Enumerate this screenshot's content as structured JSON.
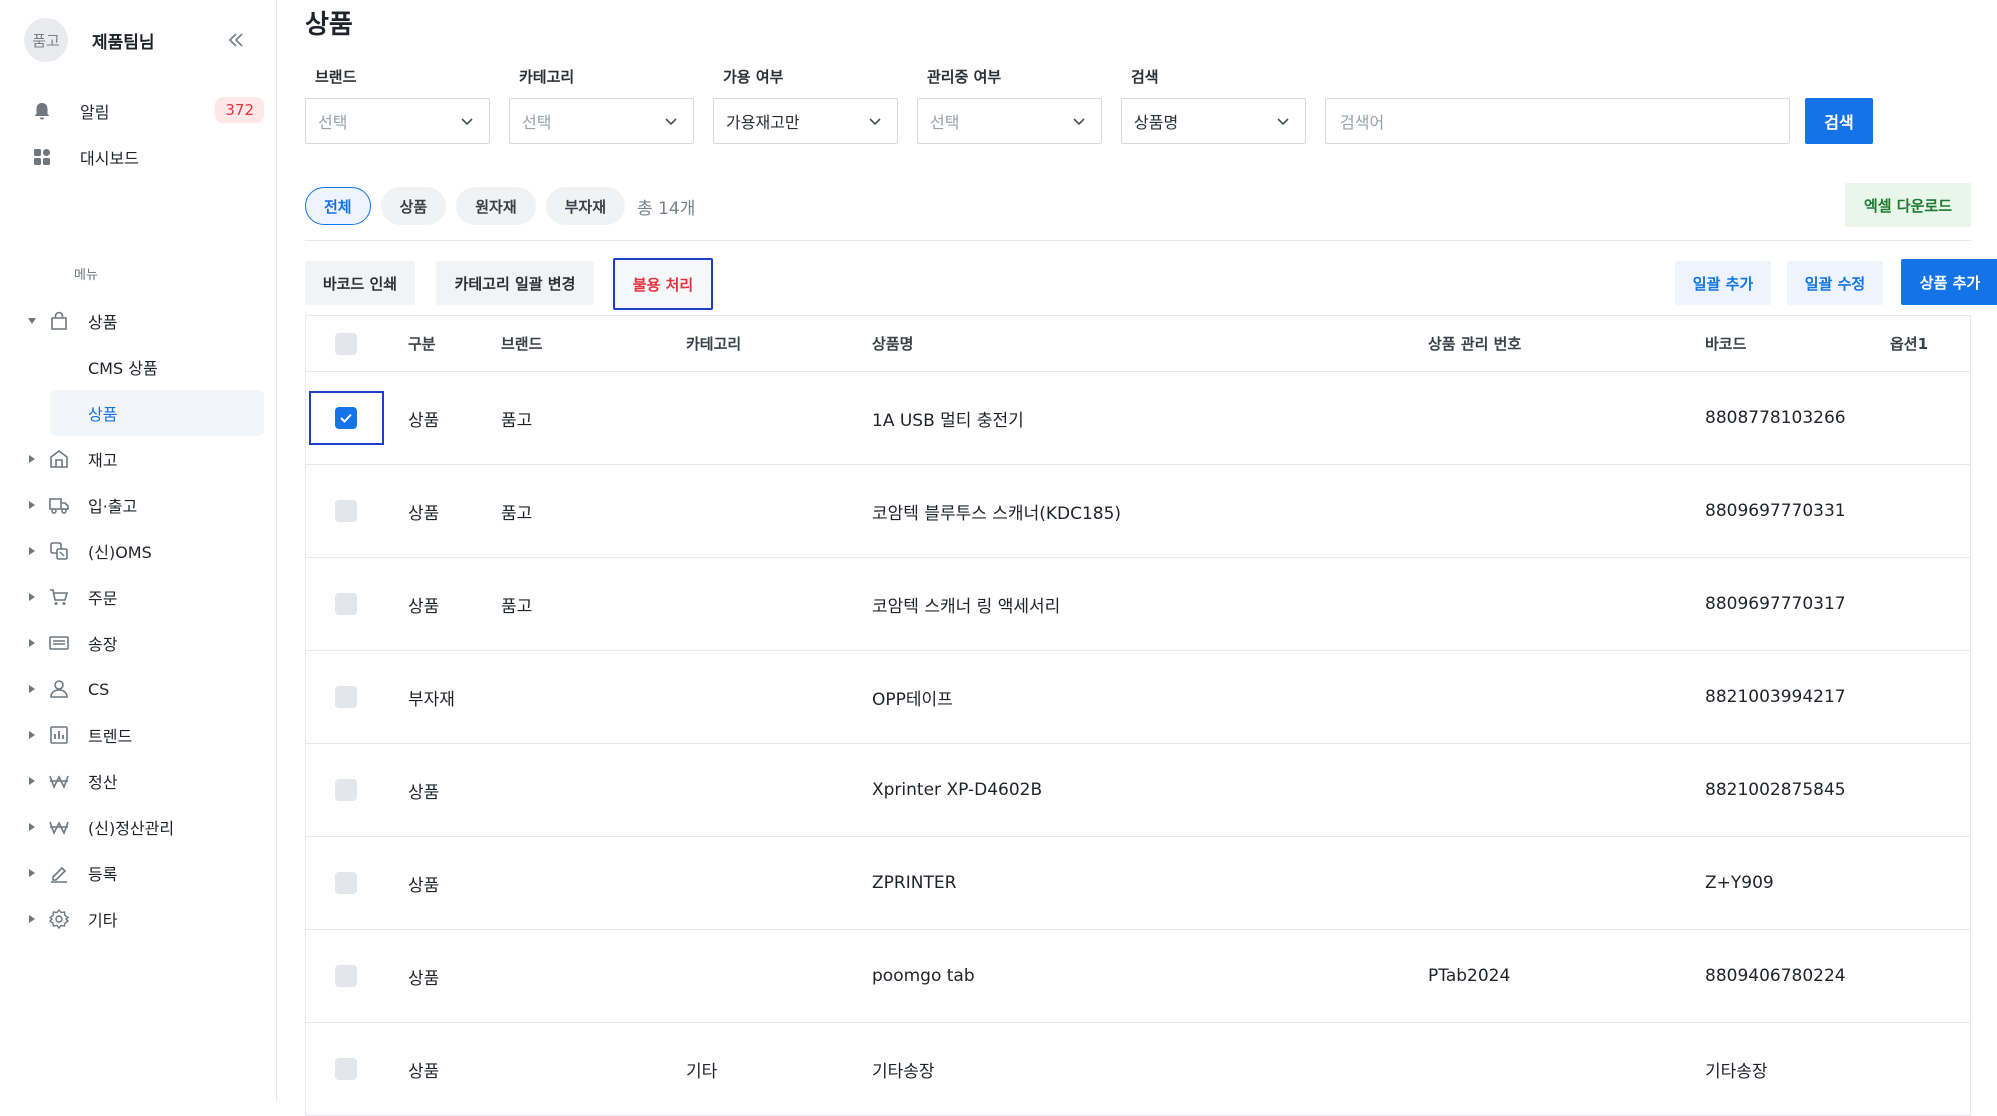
{
  "sidebar": {
    "avatar_text": "품고",
    "team_name": "제품팀님",
    "top_nav": [
      {
        "label": "알림",
        "icon": "bell-icon",
        "badge": "372"
      },
      {
        "label": "대시보드",
        "icon": "dashboard-icon"
      }
    ],
    "menu_caption": "메뉴",
    "menu": [
      {
        "label": "상품",
        "icon": "bag-icon",
        "expanded": true,
        "children": [
          {
            "label": "CMS 상품"
          },
          {
            "label": "상품",
            "active": true
          }
        ]
      },
      {
        "label": "재고",
        "icon": "warehouse-icon"
      },
      {
        "label": "입·출고",
        "icon": "truck-icon"
      },
      {
        "label": "(신)OMS",
        "icon": "sync-icon"
      },
      {
        "label": "주문",
        "icon": "cart-icon"
      },
      {
        "label": "송장",
        "icon": "invoice-icon"
      },
      {
        "label": "CS",
        "icon": "person-icon"
      },
      {
        "label": "트렌드",
        "icon": "chart-icon"
      },
      {
        "label": "정산",
        "icon": "won-icon"
      },
      {
        "label": "(신)정산관리",
        "icon": "won-icon"
      },
      {
        "label": "등록",
        "icon": "pen-icon"
      },
      {
        "label": "기타",
        "icon": "gear-icon"
      }
    ]
  },
  "page": {
    "title": "상품"
  },
  "filters": {
    "brand": {
      "label": "브랜드",
      "value": "선택"
    },
    "category": {
      "label": "카테고리",
      "value": "선택"
    },
    "availability": {
      "label": "가용 여부",
      "value": "가용재고만"
    },
    "managed": {
      "label": "관리중 여부",
      "value": "선택"
    },
    "search_type": {
      "label": "검색",
      "value": "상품명"
    },
    "search_placeholder": "검색어",
    "search_button": "검색"
  },
  "tabs": [
    "전체",
    "상품",
    "원자재",
    "부자재"
  ],
  "total_text": "총 14개",
  "excel_button": "엑셀 다운로드",
  "actions": {
    "barcode_print": "바코드 인쇄",
    "category_bulk_change": "카테고리 일괄 변경",
    "disable": "불용 처리",
    "bulk_add": "일괄 추가",
    "bulk_edit": "일괄 수정",
    "add_product": "상품 추가"
  },
  "table": {
    "headers": [
      "구분",
      "브랜드",
      "카테고리",
      "상품명",
      "상품 관리 번호",
      "바코드",
      "옵션1"
    ],
    "rows": [
      {
        "checked": true,
        "type": "상품",
        "brand": "품고",
        "category": "",
        "name": "1A USB 멀티 충전기",
        "mgmt": "",
        "barcode": "8808778103266"
      },
      {
        "checked": false,
        "type": "상품",
        "brand": "품고",
        "category": "",
        "name": "코암텍 블루투스 스캐너(KDC185)",
        "mgmt": "",
        "barcode": "8809697770331"
      },
      {
        "checked": false,
        "type": "상품",
        "brand": "품고",
        "category": "",
        "name": "코암텍 스캐너 링 액세서리",
        "mgmt": "",
        "barcode": "8809697770317"
      },
      {
        "checked": false,
        "type": "부자재",
        "brand": "",
        "category": "",
        "name": "OPP테이프",
        "mgmt": "",
        "barcode": "8821003994217"
      },
      {
        "checked": false,
        "type": "상품",
        "brand": "",
        "category": "",
        "name": "Xprinter XP-D4602B",
        "mgmt": "",
        "barcode": "8821002875845"
      },
      {
        "checked": false,
        "type": "상품",
        "brand": "",
        "category": "",
        "name": "ZPRINTER",
        "mgmt": "",
        "barcode": "Z+Y909"
      },
      {
        "checked": false,
        "type": "상품",
        "brand": "",
        "category": "",
        "name": "poomgo tab",
        "mgmt": "PTab2024",
        "barcode": "8809406780224"
      },
      {
        "checked": false,
        "type": "상품",
        "brand": "",
        "category": "기타",
        "name": "기타송장",
        "mgmt": "",
        "barcode": "기타송장"
      }
    ]
  },
  "colors": {
    "accent": "#1473e6",
    "danger": "#e5323f",
    "excel": "#1f7a32",
    "focus_outline": "#1e3ec9"
  }
}
